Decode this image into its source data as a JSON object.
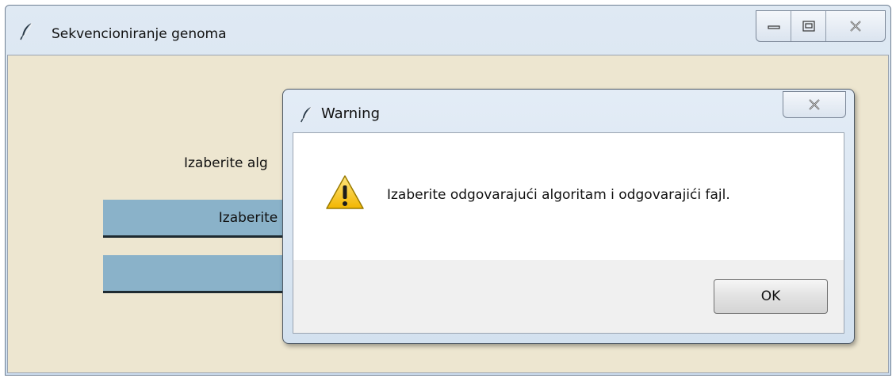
{
  "main_window": {
    "title": "Sekvencioniranje genoma",
    "prompt_text": "Izaberite alg",
    "button1_label": "Izaberite",
    "button2_label": "",
    "client_bg": "#ede6d0",
    "button_color": "#8ab2c9",
    "icons": {
      "app": "feather-icon",
      "minimize": "minimize-icon",
      "maximize": "maximize-icon",
      "close": "close-icon"
    }
  },
  "dialog": {
    "title": "Warning",
    "message": "Izaberite odgovarajući algoritam i odgovarajići fajl.",
    "ok_label": "OK",
    "icons": {
      "app": "feather-icon",
      "warning": "warning-icon",
      "close": "close-icon"
    }
  }
}
